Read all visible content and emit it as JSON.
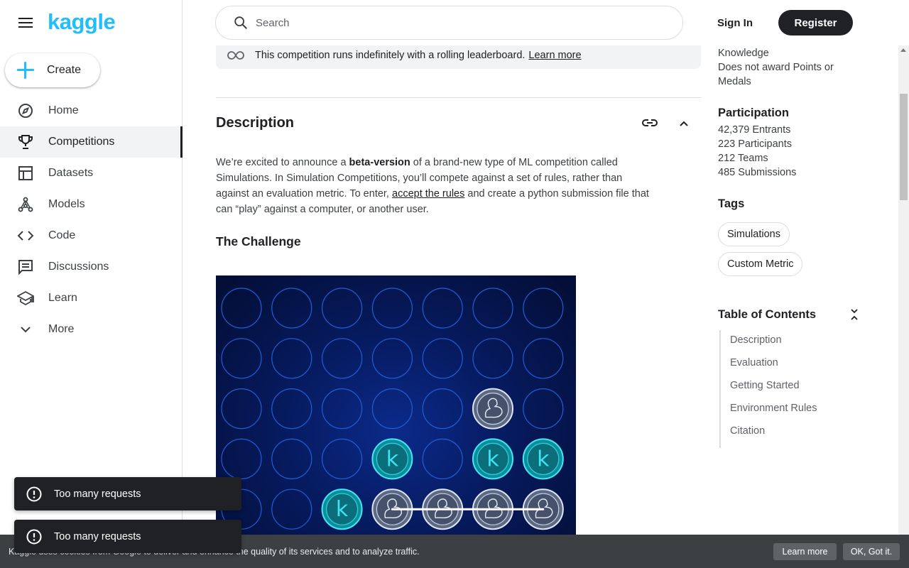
{
  "brand": {
    "logo_text": "kaggle",
    "accent": "#20beff"
  },
  "sidebar": {
    "create_label": "Create",
    "items": [
      {
        "label": "Home",
        "icon": "compass-icon"
      },
      {
        "label": "Competitions",
        "icon": "trophy-icon",
        "active": true
      },
      {
        "label": "Datasets",
        "icon": "table-icon"
      },
      {
        "label": "Models",
        "icon": "models-icon"
      },
      {
        "label": "Code",
        "icon": "code-icon"
      },
      {
        "label": "Discussions",
        "icon": "discussion-icon"
      },
      {
        "label": "Learn",
        "icon": "school-icon"
      },
      {
        "label": "More",
        "icon": "chevron-down-icon"
      }
    ]
  },
  "header": {
    "search_placeholder": "Search",
    "sign_in": "Sign In",
    "register": "Register"
  },
  "banner": {
    "text": "This competition runs indefinitely with a rolling leaderboard.",
    "link": "Learn more"
  },
  "description": {
    "title": "Description",
    "p1": "We’re excited to announce a ",
    "p1_bold": "beta-version",
    "p1_rest": " of a brand-new type of ML competition called Simulations. In Simulation Competitions, you’ll compete against a set of rules, rather than against an evaluation metric. To enter, ",
    "p1_link": "accept the rules",
    "p1_end": " and create a python submission file that can “play” against a computer, or another user.",
    "challenge_title": "The Challenge"
  },
  "board": {
    "columns": 7,
    "rows_visible": 5,
    "grid": [
      [
        "",
        "",
        "",
        "",
        "",
        "",
        ""
      ],
      [
        "",
        "",
        "",
        "",
        "",
        "",
        ""
      ],
      [
        "",
        "",
        "",
        "",
        "",
        "d",
        ""
      ],
      [
        "",
        "",
        "",
        "k",
        "",
        "k",
        "k"
      ],
      [
        "",
        "",
        "k",
        "d",
        "d",
        "d",
        "d"
      ]
    ],
    "k_letter": "k"
  },
  "info": {
    "knowledge": "Knowledge",
    "no_points": "Does not award Points or Medals",
    "participation_title": "Participation",
    "entrants": "42,379 Entrants",
    "participants": "223 Participants",
    "teams": "212 Teams",
    "submissions": "485 Submissions",
    "tags_title": "Tags",
    "tags": [
      "Simulations",
      "Custom Metric"
    ],
    "toc_title": "Table of Contents",
    "toc": [
      "Description",
      "Evaluation",
      "Getting Started",
      "Environment Rules",
      "Citation"
    ]
  },
  "cookie": {
    "text": "Kaggle uses cookies from Google to deliver and enhance the quality of its services and to analyze traffic.",
    "learn_more": "Learn more",
    "ok": "OK, Got it."
  },
  "toasts": [
    "Too many requests",
    "Too many requests"
  ]
}
